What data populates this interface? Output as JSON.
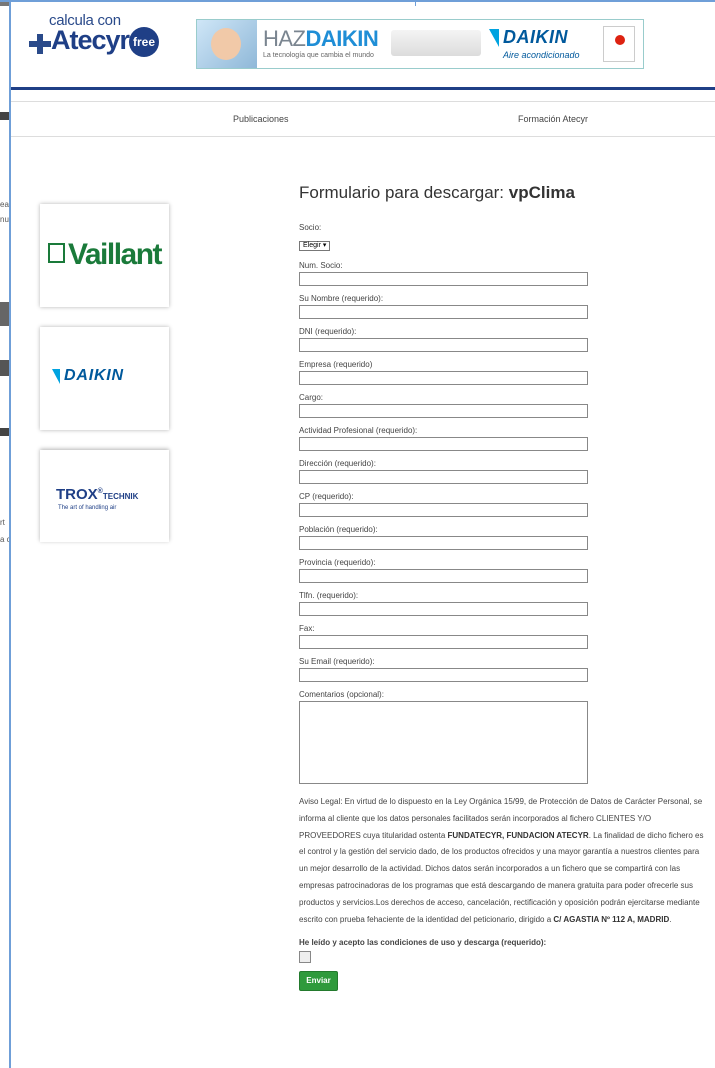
{
  "header": {
    "logo_small": "calcula con",
    "logo_big": "Atecyr",
    "logo_badge": "free",
    "banner_haz": "HAZ",
    "banner_daikin": "DAIKIN",
    "banner_tagline": "La tecnología que cambia el mundo",
    "banner_brand": "DAIKIN",
    "banner_brand_sub": "Aire acondicionado"
  },
  "nav": {
    "items": [
      "Publicaciones",
      "Formación Atecyr"
    ]
  },
  "sponsors": {
    "vaillant": "Vaillant",
    "daikin": "DAIKIN",
    "trox": "TROX",
    "trox_sub": "TECHNIK",
    "trox_tagline": "The art of handling air"
  },
  "form": {
    "title": "Formulario para descargar: ",
    "title_bold": "vpClima",
    "socio_label": "Socio:",
    "socio_value": "Elegir ▾",
    "fields": [
      "Num. Socio:",
      "Su Nombre (requerido):",
      "DNI (requerido):",
      "Empresa (requerido)",
      "Cargo:",
      "Actividad Profesional (requerido):",
      "Dirección (requerido):",
      "CP (requerido):",
      "Población (requerido):",
      "Provincia (requerido):",
      "Tlfn. (requerido):",
      "Fax:",
      "Su Email (requerido):"
    ],
    "comments_label": "Comentarios (opcional):",
    "legal_1": "Aviso Legal: En virtud de lo dispuesto en la Ley Orgánica 15/99, de Protección de Datos de Carácter Personal, se informa al cliente que los datos personales facilitados serán incorporados al fichero CLIENTES Y/O PROVEEDORES cuya titularidad ostenta ",
    "legal_bold_1": "FUNDATECYR, FUNDACION ATECYR",
    "legal_2": ". La finalidad de dicho fichero es el control y la gestión del servicio dado, de los productos ofrecidos y una mayor garantía a nuestros clientes para un mejor desarrollo de la actividad. Dichos datos serán incorporados a un fichero que se compartirá con las empresas patrocinadoras de los programas que está descargando de manera gratuita para poder ofrecerle sus productos y servicios.Los derechos de acceso, cancelación, rectificación y oposición podrán ejercitarse mediante escrito con prueba fehaciente de la identidad del peticionario, dirigido a ",
    "legal_bold_2": "C/ AGASTIA Nº 112 A, MADRID",
    "legal_3": ".",
    "agree_label": "He leído y acepto las condiciones de uso y descarga (requerido):",
    "submit_label": "Enviar"
  }
}
